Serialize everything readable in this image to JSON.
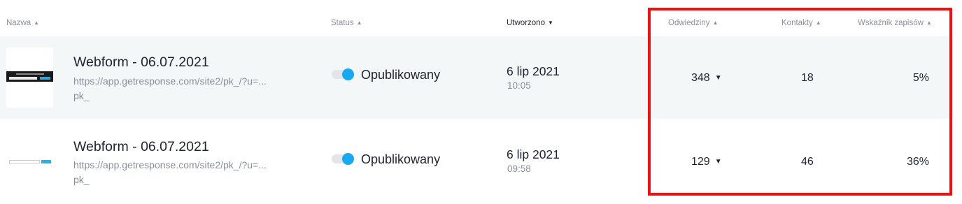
{
  "headers": {
    "name": "Nazwa",
    "status": "Status",
    "created": "Utworzono",
    "visits": "Odwiedziny",
    "contacts": "Kontakty",
    "signup_rate": "Wskaźnik zapisów"
  },
  "rows": [
    {
      "title": "Webform - 06.07.2021",
      "url_line1": "https://app.getresponse.com/site2/pk_/?u=...",
      "url_line2": "pk_",
      "status": "Opublikowany",
      "date": "6 lip 2021",
      "time": "10:05",
      "visits": "348",
      "contacts": "18",
      "rate": "5%"
    },
    {
      "title": "Webform - 06.07.2021",
      "url_line1": "https://app.getresponse.com/site2/pk_/?u=...",
      "url_line2": "pk_",
      "status": "Opublikowany",
      "date": "6 lip 2021",
      "time": "09:58",
      "visits": "129",
      "contacts": "46",
      "rate": "36%"
    }
  ],
  "colors": {
    "accent": "#16a8f0",
    "highlight": "#ee1111",
    "row_alt": "#f3f7f8"
  },
  "icons": {
    "sort_up": "caret-up-icon",
    "sort_down": "caret-down-icon",
    "visits_expand": "chevron-down-icon"
  }
}
